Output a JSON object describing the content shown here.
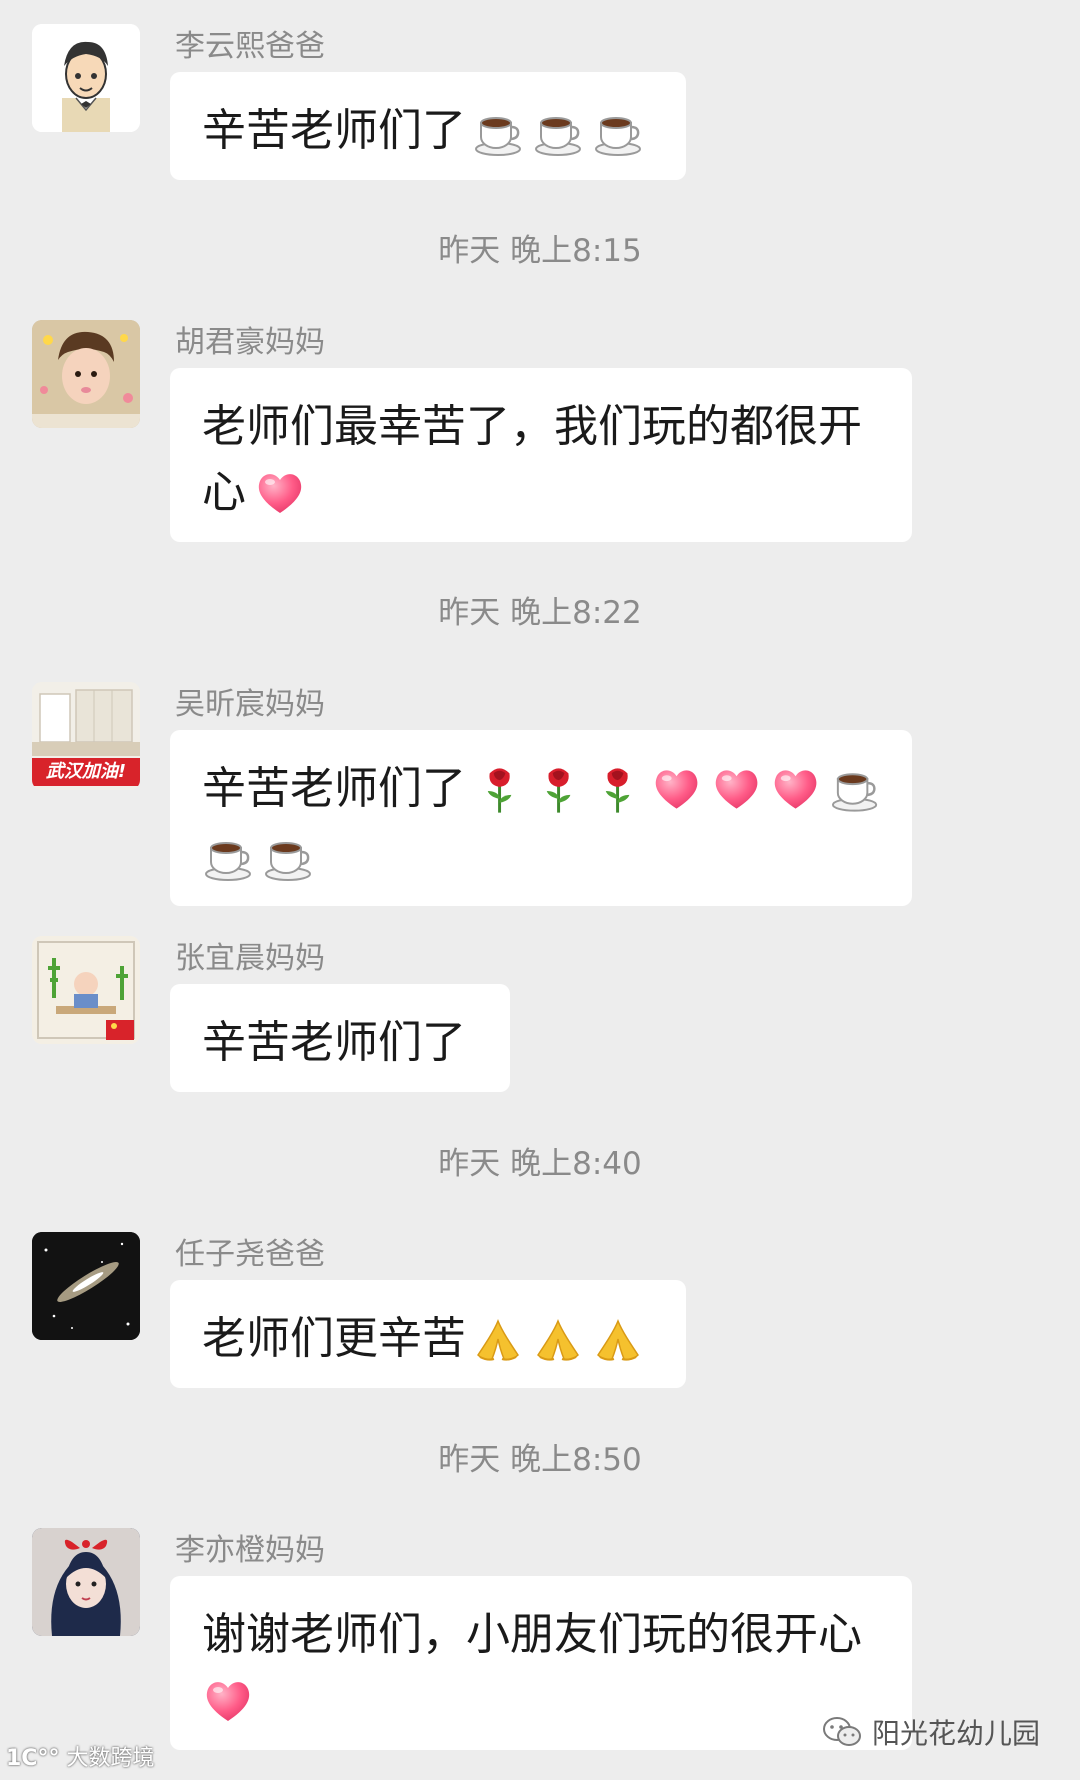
{
  "messages": [
    {
      "sender": "李云熙爸爸",
      "text": "辛苦老师们了",
      "emojis_line1": [
        "coffee-icon",
        "coffee-icon",
        "coffee-icon"
      ]
    },
    {
      "sender": "胡君豪妈妈",
      "text_line1": "老师们最幸苦了，我们玩的都很开",
      "text_line2": "心",
      "emojis_line2": [
        "heart-icon"
      ]
    },
    {
      "sender": "吴昕宸妈妈",
      "text": "辛苦老师们了",
      "emojis_line1": [
        "rose-icon",
        "rose-icon",
        "rose-icon",
        "heart-icon",
        "heart-icon",
        "heart-icon",
        "coffee-icon"
      ],
      "emojis_line2": [
        "coffee-icon",
        "coffee-icon"
      ],
      "avatar_badge": "武汉加油!"
    },
    {
      "sender": "张宜晨妈妈",
      "text": "辛苦老师们了"
    },
    {
      "sender": "任子尧爸爸",
      "text": "老师们更辛苦",
      "emojis_line1": [
        "pray-icon",
        "pray-icon",
        "pray-icon"
      ]
    },
    {
      "sender": "李亦橙妈妈",
      "text_line1": "谢谢老师们，小朋友们玩的很开心",
      "emojis_line2": [
        "heart-icon"
      ]
    }
  ],
  "timestamps": [
    "昨天 晚上8:15",
    "昨天 晚上8:22",
    "昨天 晚上8:40",
    "昨天 晚上8:50"
  ],
  "footer": {
    "left_watermark": "大数跨境",
    "right_account": "阳光花幼儿园"
  },
  "colors": {
    "background": "#ededed",
    "bubble": "#ffffff",
    "meta_text": "#8a8a8a",
    "heart": "#ff4d7a",
    "rose": "#d81e2c"
  }
}
